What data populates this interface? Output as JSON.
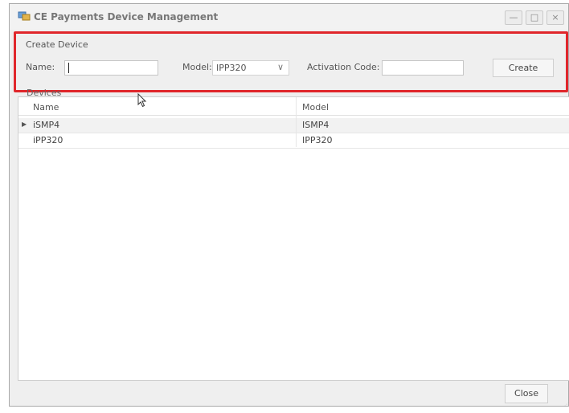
{
  "window": {
    "title": "CE Payments Device Management",
    "controls": {
      "minimize": "—",
      "maximize": "□",
      "close": "×"
    }
  },
  "create_device": {
    "section_title": "Create Device",
    "name_label": "Name:",
    "name_value": "",
    "model_label": "Model:",
    "model_value": "IPP320",
    "activation_label": "Activation Code:",
    "activation_value": "",
    "create_button": "Create",
    "highlight_color": "#e0262b"
  },
  "devices": {
    "section_title": "Devices",
    "columns": [
      "Name",
      "Model"
    ],
    "rows": [
      {
        "name": "iSMP4",
        "model": "ISMP4",
        "selected": true
      },
      {
        "name": "iPP320",
        "model": "IPP320",
        "selected": false
      }
    ]
  },
  "footer": {
    "close_button": "Close"
  }
}
